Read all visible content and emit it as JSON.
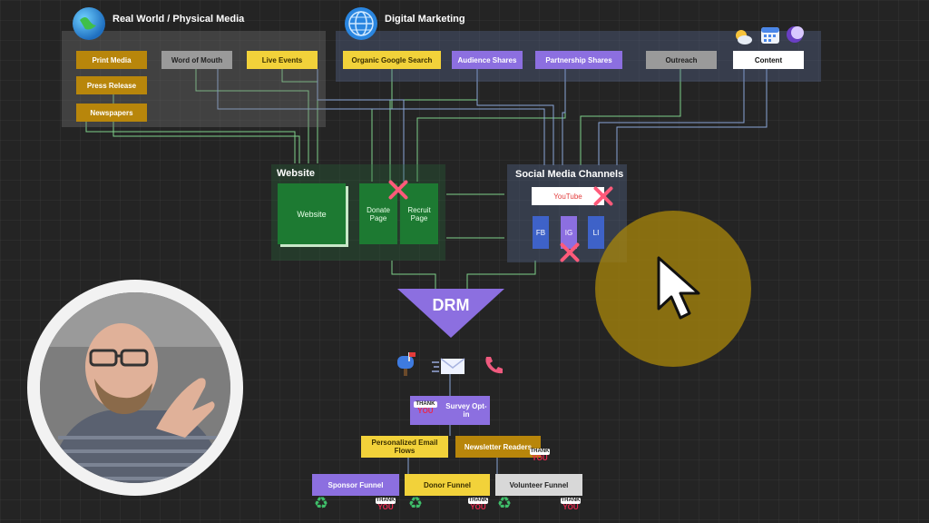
{
  "groups": {
    "real_world": {
      "title": "Real World / Physical Media"
    },
    "digital": {
      "title": "Digital Marketing"
    },
    "website": {
      "title": "Website"
    },
    "social": {
      "title": "Social Media Channels"
    }
  },
  "nodes": {
    "print_media": "Print Media",
    "press_release": "Press Release",
    "newspapers": "Newspapers",
    "word_of_mouth": "Word of Mouth",
    "live_events": "Live Events",
    "organic_google": "Organic Google Search",
    "audience_shares": "Audience Shares",
    "partnership_shares": "Partnership Shares",
    "outreach": "Outreach",
    "content": "Content",
    "website": "Website",
    "donate_page": "Donate\nPage",
    "recruit_page": "Recruit\nPage",
    "youtube": "YouTube",
    "fb": "FB",
    "ig": "IG",
    "li": "LI",
    "drm": "DRM",
    "survey_optin": "Survey Opt-in",
    "personalized_email": "Personalized Email Flows",
    "newsletter_readers": "Newsletter Readers",
    "sponsor_funnel": "Sponsor Funnel",
    "donor_funnel": "Donor Funnel",
    "volunteer_funnel": "Volunteer Funnel"
  },
  "stickers": {
    "thank": "THANK",
    "you": "YOU"
  },
  "colors": {
    "brown": "#b8860b",
    "yellow": "#f2d23a",
    "purple": "#8c6fe0",
    "gray": "#9a9a9a",
    "green": "#1d7a32",
    "social_blue": "#3e62c8",
    "lines": "#7ecf8a",
    "cancel": "#ff5a7a"
  },
  "icons": [
    "globe-icon",
    "mailbox-icon",
    "email-icon",
    "phone-icon",
    "weather-icon",
    "calendar-icon",
    "moon-icon",
    "recycle-icon",
    "cursor-icon",
    "x-mark-icon"
  ]
}
